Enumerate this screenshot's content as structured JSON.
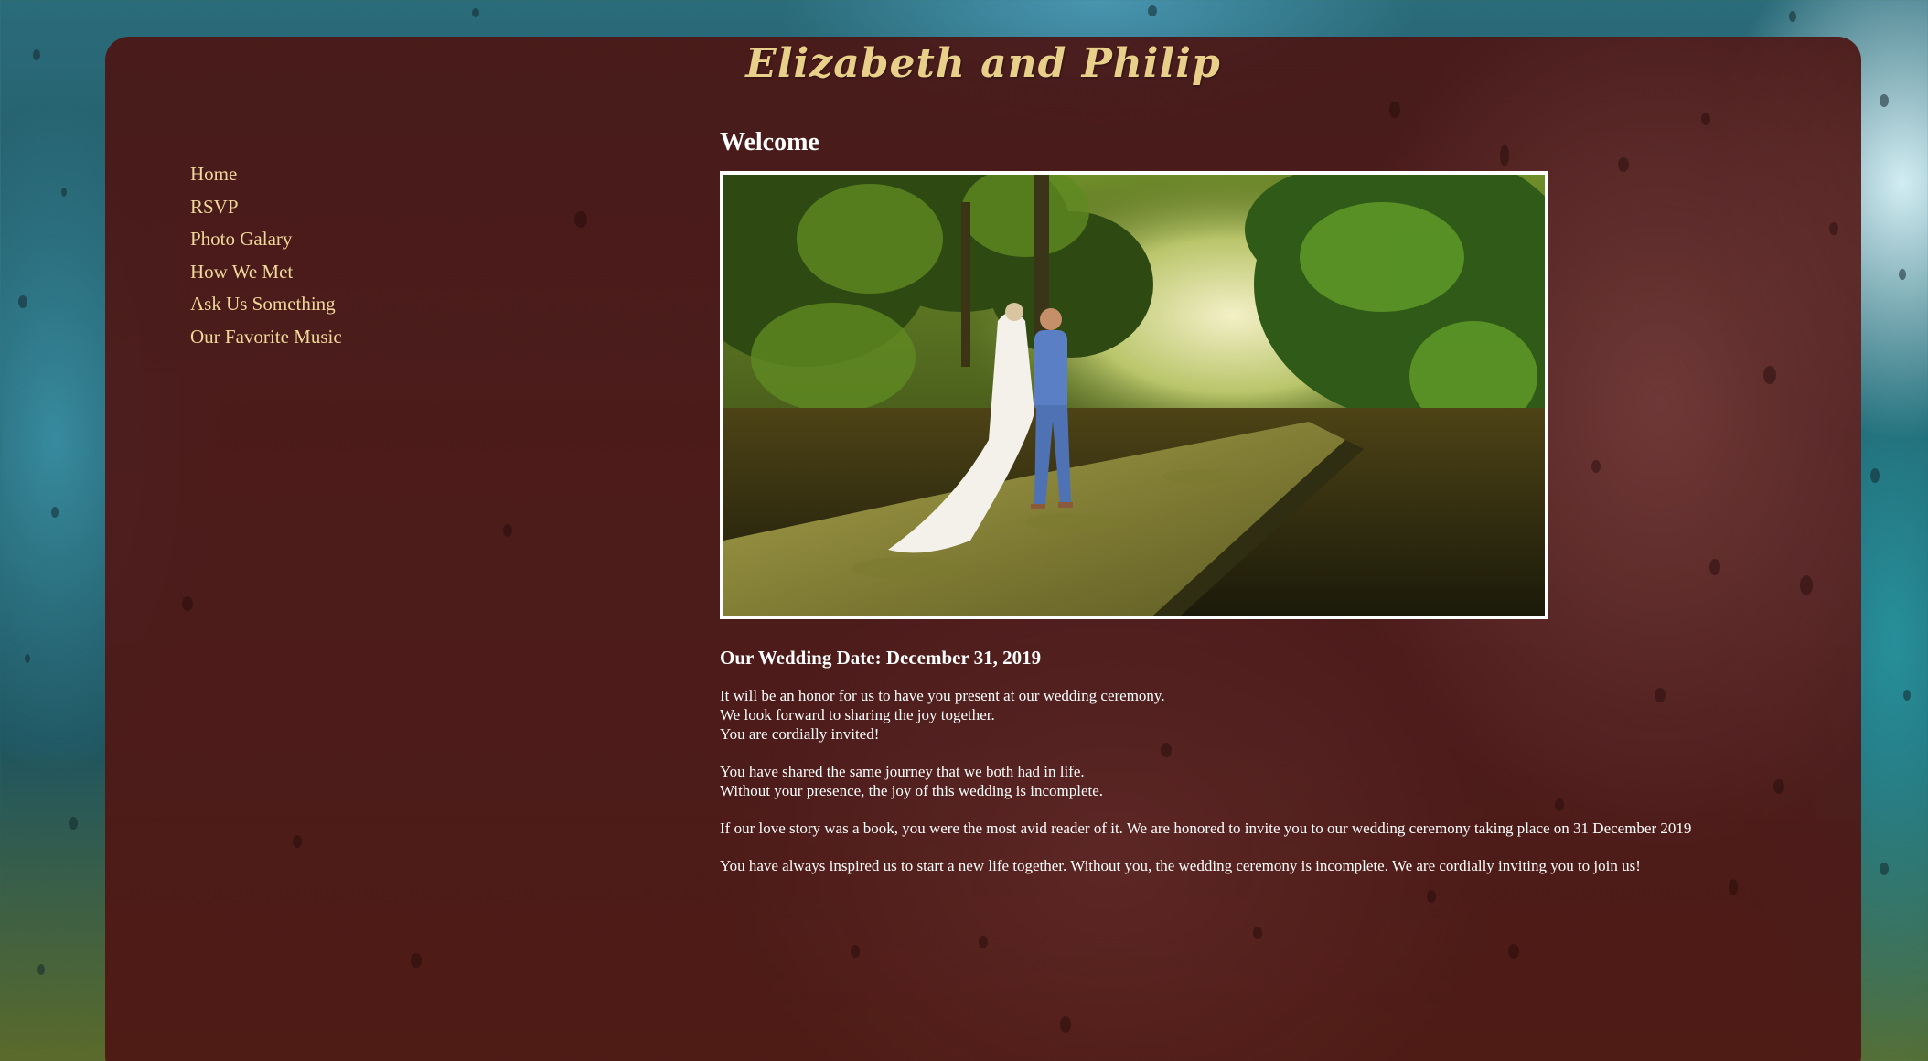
{
  "site": {
    "title": "Elizabeth and Philip"
  },
  "nav": {
    "items": [
      {
        "label": "Home"
      },
      {
        "label": "RSVP"
      },
      {
        "label": "Photo Galary"
      },
      {
        "label": "How We Met"
      },
      {
        "label": "Ask Us Something"
      },
      {
        "label": "Our Favorite Music"
      }
    ]
  },
  "main": {
    "heading": "Welcome",
    "photo_alt": "",
    "wedding_date": "Our Wedding Date: December 31, 2019",
    "paragraphs": [
      {
        "lines": [
          "It will be an honor for us to have you present at our wedding ceremony.",
          "We look forward to sharing the joy together.",
          "You are cordially invited!"
        ]
      },
      {
        "lines": [
          "You have shared the same journey that we both had in life.",
          "Without your presence, the joy of this wedding is incomplete."
        ]
      },
      {
        "lines": [
          "If our love story was a book, you were the most avid reader of it. We are honored to invite you to our wedding ceremony taking place on 31 December 2019"
        ]
      },
      {
        "lines": [
          "You have always inspired us to start a new life together. Without you, the wedding ceremony is incomplete. We are cordially inviting you to join us!"
        ]
      }
    ]
  },
  "colors": {
    "panel": "#4b1614",
    "title": "#e8cf8a",
    "nav_link": "#f0d79a",
    "text": "#ffffff"
  }
}
